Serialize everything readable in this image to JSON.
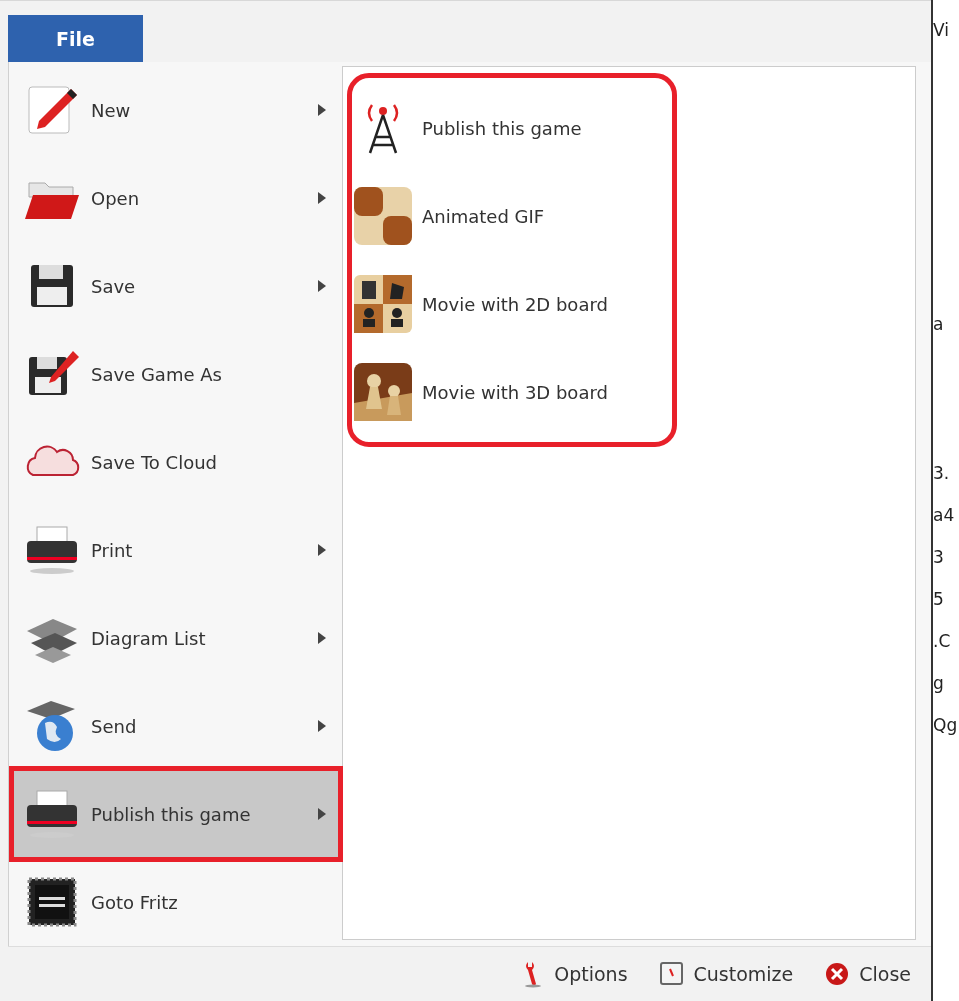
{
  "tab": {
    "label": "File",
    "selected": true
  },
  "menu_items": [
    {
      "label": "New",
      "has_submenu": true,
      "selected": false,
      "highlighted": false
    },
    {
      "label": "Open",
      "has_submenu": true,
      "selected": false,
      "highlighted": false
    },
    {
      "label": "Save",
      "has_submenu": true,
      "selected": false,
      "highlighted": false
    },
    {
      "label": "Save Game As",
      "has_submenu": false,
      "selected": false,
      "highlighted": false
    },
    {
      "label": "Save To Cloud",
      "has_submenu": false,
      "selected": false,
      "highlighted": false
    },
    {
      "label": "Print",
      "has_submenu": true,
      "selected": false,
      "highlighted": false
    },
    {
      "label": "Diagram List",
      "has_submenu": true,
      "selected": false,
      "highlighted": false
    },
    {
      "label": "Send",
      "has_submenu": true,
      "selected": false,
      "highlighted": false
    },
    {
      "label": "Publish this game",
      "has_submenu": true,
      "selected": true,
      "highlighted": true
    },
    {
      "label": "Goto Fritz",
      "has_submenu": false,
      "selected": false,
      "highlighted": false
    }
  ],
  "submenu": {
    "highlighted": true,
    "items": [
      {
        "label": "Publish this game"
      },
      {
        "label": "Animated GIF"
      },
      {
        "label": "Movie with 2D board"
      },
      {
        "label": "Movie with 3D board"
      }
    ]
  },
  "footer_buttons": [
    {
      "label": "Options"
    },
    {
      "label": "Customize"
    },
    {
      "label": "Close"
    }
  ],
  "background_fragments": [
    {
      "text": "Vi"
    },
    {
      "text": "a"
    },
    {
      "text": "3."
    },
    {
      "text": "a4"
    },
    {
      "text": "3"
    },
    {
      "text": "5"
    },
    {
      "text": ".C"
    },
    {
      "text": "g"
    },
    {
      "text": "Qg"
    }
  ]
}
